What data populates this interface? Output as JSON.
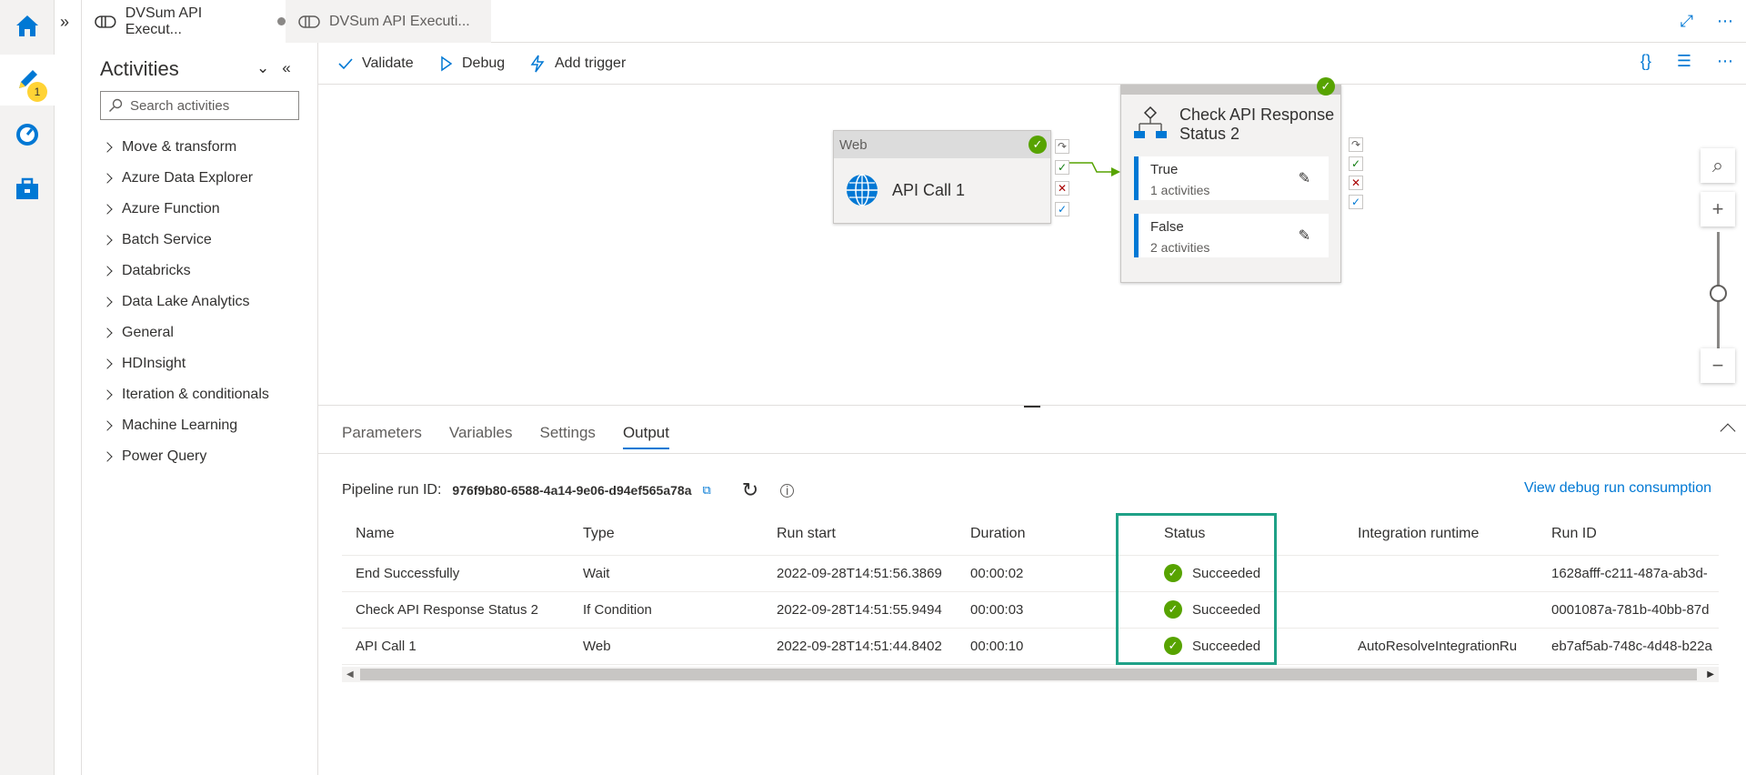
{
  "tabs": [
    {
      "label": "DVSum API Execut..."
    },
    {
      "label": "DVSum API Executi..."
    }
  ],
  "rail": {
    "badge": "1"
  },
  "activities": {
    "title": "Activities",
    "search_placeholder": "Search activities",
    "categories": [
      "Move & transform",
      "Azure Data Explorer",
      "Azure Function",
      "Batch Service",
      "Databricks",
      "Data Lake Analytics",
      "General",
      "HDInsight",
      "Iteration & conditionals",
      "Machine Learning",
      "Power Query"
    ]
  },
  "toolbar": {
    "validate": "Validate",
    "debug": "Debug",
    "add_trigger": "Add trigger"
  },
  "canvas": {
    "web_node": {
      "type": "Web",
      "name": "API Call 1"
    },
    "if_node": {
      "title_line1": "Check API Response",
      "title_line2": "Status 2",
      "true_label": "True",
      "true_count": "1 activities",
      "false_label": "False",
      "false_count": "2 activities"
    }
  },
  "bottom": {
    "tabs": [
      "Parameters",
      "Variables",
      "Settings",
      "Output"
    ],
    "run_id_label": "Pipeline run ID:",
    "run_id_value": "976f9b80-6588-4a14-9e06-d94ef565a78a",
    "view_debug": "View debug run consumption",
    "columns": [
      "Name",
      "Type",
      "Run start",
      "Duration",
      "Status",
      "Integration runtime",
      "Run ID"
    ],
    "rows": [
      {
        "name": "End Successfully",
        "type": "Wait",
        "run_start": "2022-09-28T14:51:56.3869",
        "duration": "00:00:02",
        "status": "Succeeded",
        "runtime": "",
        "run_id": "1628afff-c211-487a-ab3d-"
      },
      {
        "name": "Check API Response Status 2",
        "type": "If Condition",
        "run_start": "2022-09-28T14:51:55.9494",
        "duration": "00:00:03",
        "status": "Succeeded",
        "runtime": "",
        "run_id": "0001087a-781b-40bb-87d"
      },
      {
        "name": "API Call 1",
        "type": "Web",
        "run_start": "2022-09-28T14:51:44.8402",
        "duration": "00:00:10",
        "status": "Succeeded",
        "runtime": "AutoResolveIntegrationRu",
        "run_id": "eb7af5ab-748c-4d48-b22a"
      }
    ]
  },
  "colors": {
    "accent": "#0078d4",
    "success": "#57a300",
    "highlight": "#1fa187"
  }
}
